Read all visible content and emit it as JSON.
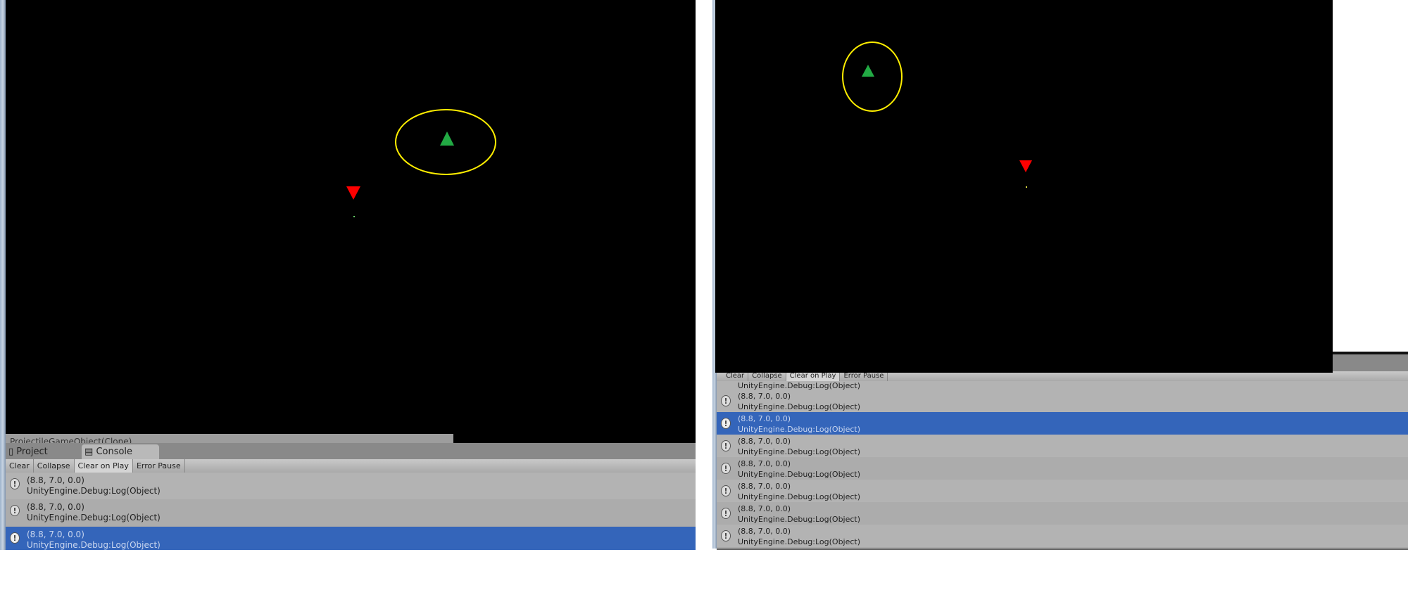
{
  "left": {
    "hierarchy_item": "ProjectileGameObject(Clone)",
    "tabs": [
      {
        "label": "Project",
        "icon": "folder-icon"
      },
      {
        "label": "Console",
        "icon": "console-icon",
        "active": true
      }
    ],
    "toolbar": [
      "Clear",
      "Collapse",
      "Clear on Play",
      "Error Pause"
    ],
    "active_toolbar": "Clear on Play",
    "logs": [
      {
        "line1": "(8.8, 7.0, 0.0)",
        "line2": "UnityEngine.Debug:Log(Object)",
        "selected": false
      },
      {
        "line1": "(8.8, 7.0, 0.0)",
        "line2": "UnityEngine.Debug:Log(Object)",
        "selected": false
      },
      {
        "line1": "(8.8, 7.0, 0.0)",
        "line2": "UnityEngine.Debug:Log(Object)",
        "selected": true
      }
    ]
  },
  "right": {
    "toolbar": [
      "Clear",
      "Collapse",
      "Clear on Play",
      "Error Pause"
    ],
    "partial_log": "UnityEngine.Debug:Log(Object)",
    "logs": [
      {
        "line1": "(8.8, 7.0, 0.0)",
        "line2": "UnityEngine.Debug:Log(Object)",
        "selected": false
      },
      {
        "line1": "(8.8, 7.0, 0.0)",
        "line2": "UnityEngine.Debug:Log(Object)",
        "selected": true
      },
      {
        "line1": "(8.8, 7.0, 0.0)",
        "line2": "UnityEngine.Debug:Log(Object)",
        "selected": false
      },
      {
        "line1": "(8.8, 7.0, 0.0)",
        "line2": "UnityEngine.Debug:Log(Object)",
        "selected": false
      },
      {
        "line1": "(8.8, 7.0, 0.0)",
        "line2": "UnityEngine.Debug:Log(Object)",
        "selected": false
      },
      {
        "line1": "(8.8, 7.0, 0.0)",
        "line2": "UnityEngine.Debug:Log(Object)",
        "selected": false
      },
      {
        "line1": "(8.8, 7.0, 0.0)",
        "line2": "UnityEngine.Debug:Log(Object)",
        "selected": false
      }
    ]
  },
  "colors": {
    "selection": "#3465ba",
    "player": "#22aa44",
    "enemy": "#ff0000",
    "highlight": "#ffee00"
  }
}
